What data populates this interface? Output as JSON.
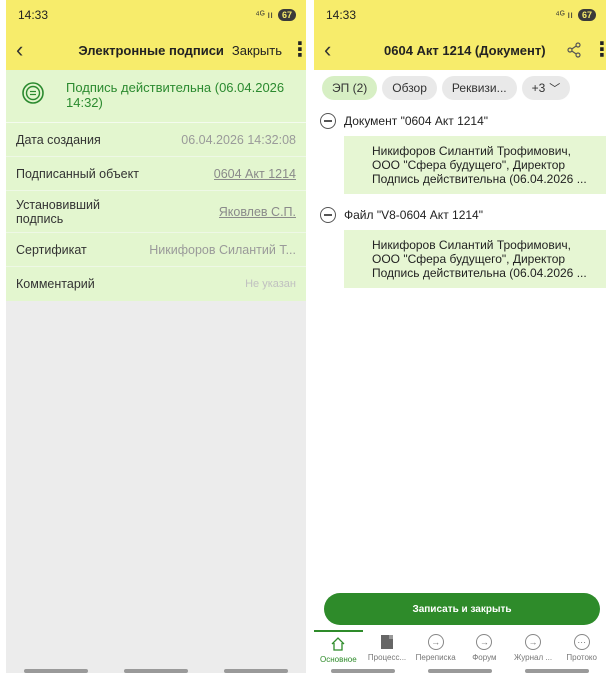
{
  "left": {
    "status": {
      "time": "14:33",
      "signal": "⁴ᴳ ıı",
      "battery": "67"
    },
    "header": {
      "back": "‹",
      "title": "Электронные подписи",
      "close_label": "Закрыть",
      "menu": "⋮"
    },
    "validity": {
      "text": "Подпись действительна (06.04.2026 14:32)"
    },
    "properties": [
      {
        "label": "Дата создания",
        "value": "06.04.2026 14:32:08"
      },
      {
        "label": "Подписанный объект",
        "value": "0604 Акт 1214"
      },
      {
        "label": "Установивший подпись",
        "value": "Яковлев С.П."
      },
      {
        "label": "Сертификат",
        "value": "Никифоров Силантий Т..."
      },
      {
        "label": "Комментарий",
        "value": "Не указан"
      }
    ]
  },
  "right": {
    "status": {
      "time": "14:33",
      "signal": "⁴ᴳ ıı",
      "battery": "67"
    },
    "header": {
      "back": "‹",
      "title": "0604 Акт 1214 (Документ)",
      "menu": "⋮"
    },
    "tabs": [
      {
        "label": "ЭП (2)"
      },
      {
        "label": "Обзор"
      },
      {
        "label": "Реквизи..."
      },
      {
        "label": "+3"
      }
    ],
    "sections": [
      {
        "title": "Документ \"0604 Акт 1214\"",
        "signer": "Никифоров Силантий Трофимович,",
        "org": "ООО \"Сфера будущего\", Директор",
        "status": "Подпись действительна (06.04.2026 ..."
      },
      {
        "title": "Файл \"V8-0604 Акт 1214\"",
        "signer": "Никифоров Силантий Трофимович,",
        "org": "ООО \"Сфера будущего\", Директор",
        "status": "Подпись действительна (06.04.2026 ..."
      }
    ],
    "save_button": "Записать и закрыть",
    "bottom_tabs": [
      {
        "label": "Основное"
      },
      {
        "label": "Процесс..."
      },
      {
        "label": "Переписка"
      },
      {
        "label": "Форум"
      },
      {
        "label": "Журнал ..."
      },
      {
        "label": "Протоко"
      }
    ]
  },
  "colors": {
    "header_yellow": "#f7ec6b",
    "accent_green": "#2e8b2a",
    "valid_green": "#2b8a2f",
    "panel_green": "#e3f6cf"
  }
}
